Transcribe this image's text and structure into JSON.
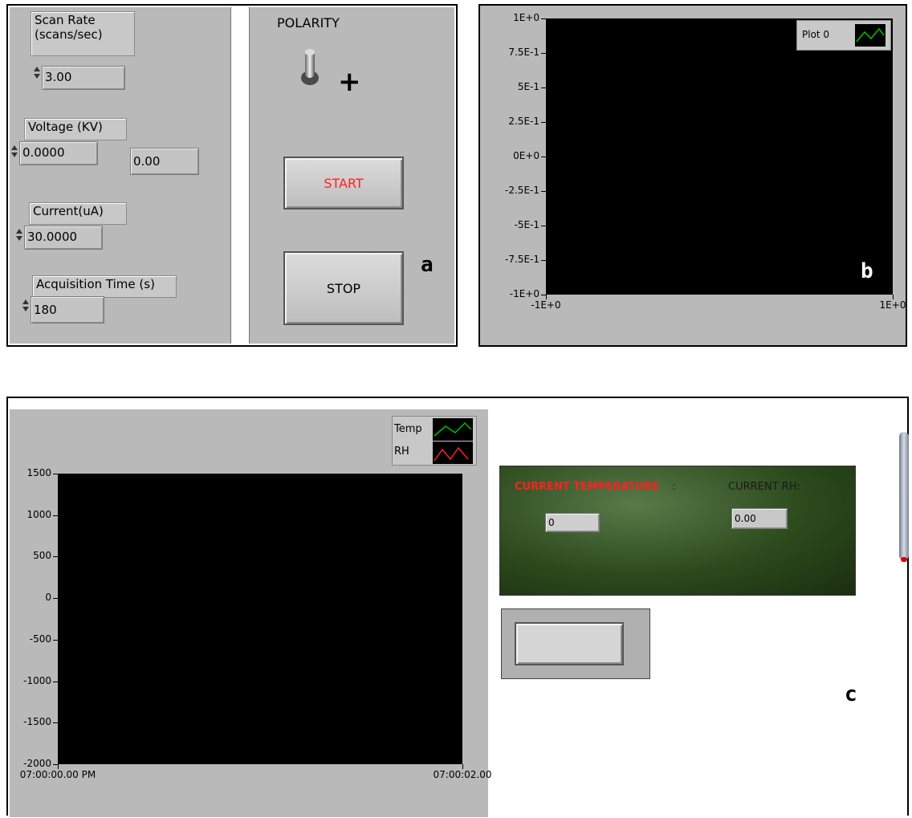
{
  "panel_a": {
    "scan_rate_label": "Scan Rate\n(scans/sec)",
    "scan_rate_value": "3.00",
    "voltage_label": "Voltage (KV)",
    "voltage_value": "0.0000",
    "voltage_readout": "0.00",
    "current_label": "Current(uA)",
    "current_value": "30.0000",
    "acq_time_label": "Acquisition Time (s)",
    "acq_time_value": "180",
    "polarity_label": "POLARITY",
    "polarity_sign": "+",
    "start_label": "START",
    "stop_label": "STOP",
    "corner_letter": "a"
  },
  "panel_b": {
    "legend": "Plot 0",
    "y_ticks": [
      "1E+0",
      "7.5E-1",
      "5E-1",
      "2.5E-1",
      "0E+0",
      "-2.5E-1",
      "-5E-1",
      "-7.5E-1",
      "-1E+0"
    ],
    "x_ticks": [
      "-1E+0",
      "1E+0"
    ],
    "corner_letter": "b"
  },
  "panel_c": {
    "legend": [
      "Temp",
      "RH"
    ],
    "y_ticks": [
      "1500",
      "1000",
      "500",
      "0",
      "-500",
      "-1000",
      "-1500",
      "-2000"
    ],
    "x_ticks": [
      "07:00:00.00 PM",
      "07:00:02.00"
    ],
    "current_temp_label": "CURRENT TEMPERATURE",
    "current_temp_colon": ":",
    "current_temp_value": "0",
    "current_rh_label": "CURRENT RH:",
    "current_rh_value": "0.00",
    "corner_letter": "c"
  },
  "colors": {
    "panel_grey": "#b9b9b9",
    "plot_bg": "#000000",
    "start_text": "#ff2020",
    "temp_line": "#00c000",
    "rh_line": "#ff2020",
    "green_panel": "#2a4a1a"
  }
}
